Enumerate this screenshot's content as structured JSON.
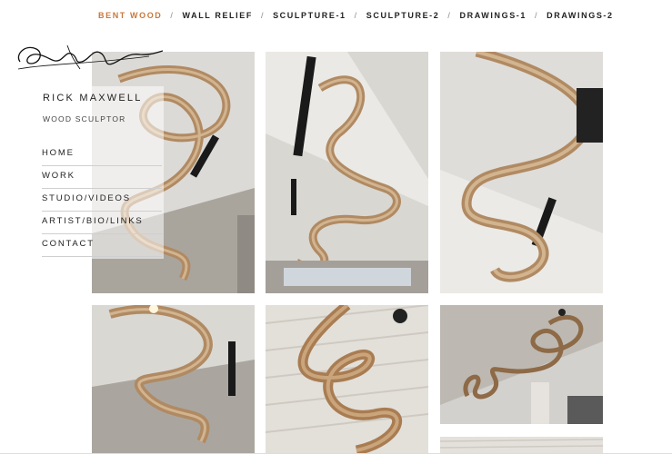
{
  "topnav": {
    "items": [
      {
        "label": "BENT WOOD",
        "active": true
      },
      {
        "label": "WALL RELIEF",
        "active": false
      },
      {
        "label": "SCULPTURE-1",
        "active": false
      },
      {
        "label": "SCULPTURE-2",
        "active": false
      },
      {
        "label": "DRAWINGS-1",
        "active": false
      },
      {
        "label": "DRAWINGS-2",
        "active": false
      }
    ],
    "separator": "/",
    "active_color": "#c8783c"
  },
  "brand": {
    "name": "RICK MAXWELL",
    "subtitle": "WOOD SCULPTOR"
  },
  "sidenav": {
    "items": [
      "HOME",
      "WORK",
      "STUDIO/VIDEOS",
      "ARTIST/BIO/LINKS",
      "CONTACT"
    ]
  },
  "gallery": {
    "photos": [
      {
        "subject": "bent wood sculpture photo 1"
      },
      {
        "subject": "bent wood sculpture photo 2"
      },
      {
        "subject": "bent wood sculpture photo 3"
      },
      {
        "subject": "bent wood sculpture photo 4"
      },
      {
        "subject": "bent wood sculpture photo 5"
      },
      {
        "subject": "bent wood sculpture photo 6"
      },
      {
        "subject": "bent wood sculpture photo 7"
      }
    ]
  },
  "colors": {
    "wood": "#b08a63",
    "wood_light": "#d2b48f",
    "text": "#222222"
  }
}
